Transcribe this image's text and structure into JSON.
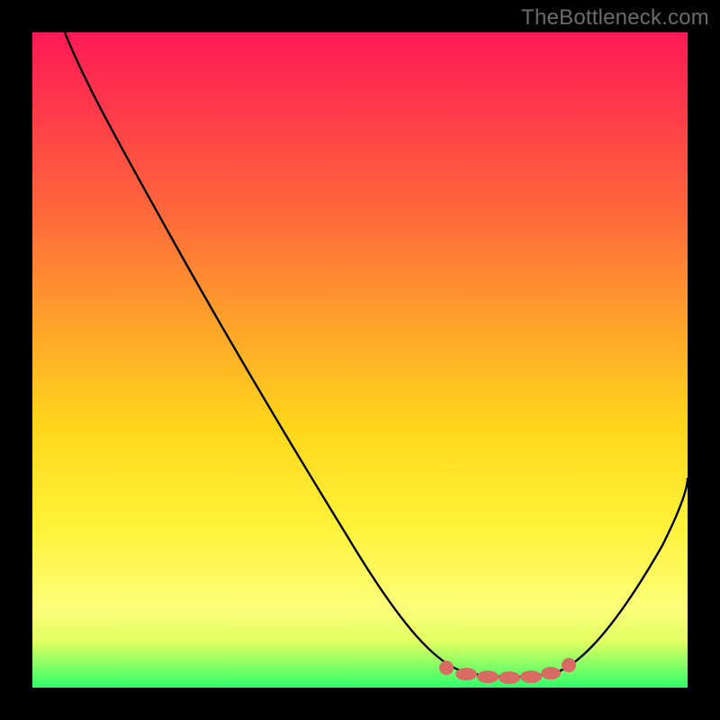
{
  "watermark": "TheBottleneck.com",
  "colors": {
    "background": "#000000",
    "gradient_top": "#ff1a56",
    "gradient_bottom": "#2fff6a",
    "curve_stroke": "#000000",
    "marker": "#d86b63",
    "watermark_text": "#6b6b6b"
  },
  "chart_data": {
    "type": "line",
    "title": "",
    "xlabel": "",
    "ylabel": "",
    "xlim": [
      0,
      100
    ],
    "ylim": [
      0,
      100
    ],
    "description": "V-shaped bottleneck curve. Left branch descends steeply from (~5,100) to a flat minimum around x=66–80 at y≈2, then rises to (~100,32). Valley floor marked with salmon dots showing optimal range.",
    "series": [
      {
        "name": "bottleneck-curve",
        "x": [
          5,
          10,
          15,
          20,
          25,
          30,
          35,
          40,
          45,
          50,
          55,
          60,
          64,
          68,
          72,
          76,
          80,
          84,
          88,
          92,
          96,
          100
        ],
        "y": [
          100,
          93,
          85,
          77,
          69,
          61,
          53,
          45,
          37,
          29,
          21,
          13,
          6,
          3,
          2,
          2,
          3,
          7,
          13,
          19,
          25,
          32
        ]
      }
    ],
    "markers": {
      "name": "optimal-range",
      "x": [
        63,
        66,
        69,
        72,
        75,
        78,
        81
      ],
      "y": [
        5,
        3,
        2.5,
        2,
        2,
        2.5,
        4
      ]
    }
  }
}
